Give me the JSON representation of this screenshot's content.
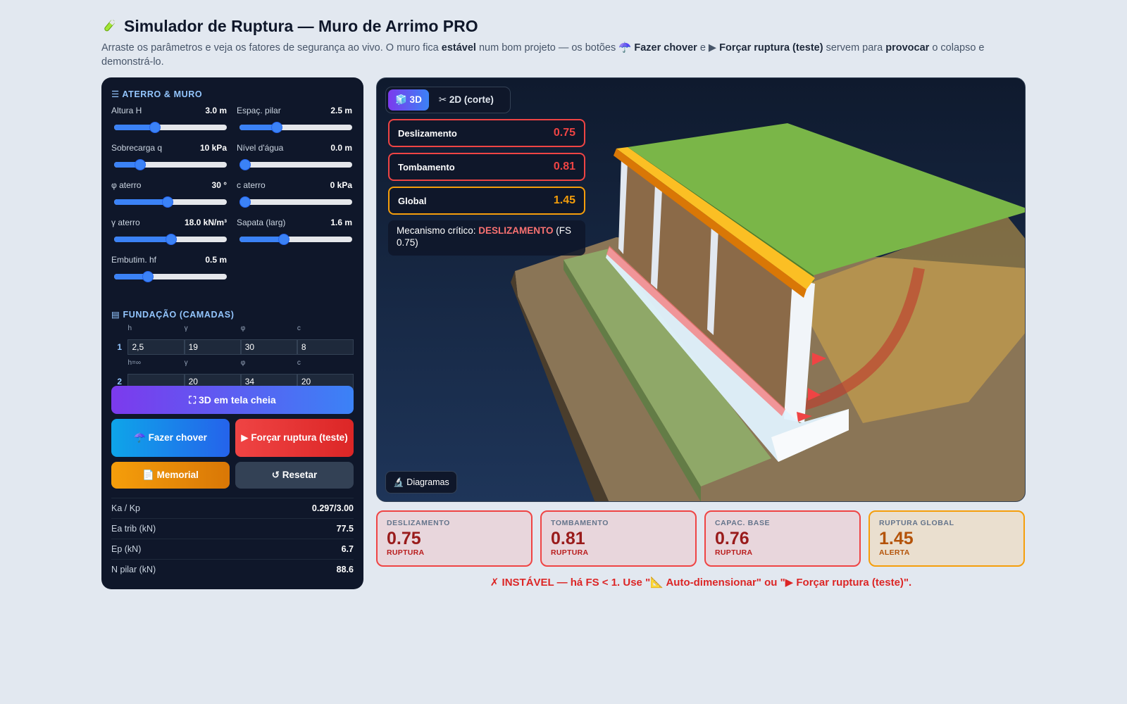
{
  "header": {
    "title": "Simulador de Ruptura — Muro de Arrimo PRO",
    "subtitle_parts": [
      "Arraste os parâmetros e veja os fatores de segurança ao vivo. O muro fica ",
      "estável",
      " num bom projeto — os botões ☂️ ",
      "Fazer chover",
      " e ▶ ",
      "Forçar ruptura (teste)",
      " servem para ",
      "provocar",
      " o colapso e demonstrá-lo."
    ]
  },
  "panel": {
    "section1": "☰ ATERRO & MURO",
    "sliders": [
      {
        "label": "Altura H",
        "value": "3.0 m",
        "level": 0.35
      },
      {
        "label": "Espaç. pilar",
        "value": "2.5 m",
        "level": 0.31
      },
      {
        "label": "Sobrecarga q",
        "value": "10 kPa",
        "level": 0.2
      },
      {
        "label": "Nível d'água",
        "value": "0.0 m",
        "level": 0.0
      },
      {
        "label": "φ aterro",
        "value": "30 °",
        "level": 0.47
      },
      {
        "label": "c aterro",
        "value": "0 kPa",
        "level": 0.0
      },
      {
        "label": "γ aterro",
        "value": "18.0 kN/m³",
        "level": 0.51
      },
      {
        "label": "Sapata (larg)",
        "value": "1.6 m",
        "level": 0.38
      },
      {
        "label": "Embutim. hf",
        "value": "0.5 m",
        "level": 0.28
      }
    ],
    "section2": "▤ FUNDAÇÃO (CAMADAS)",
    "layers": [
      {
        "num": "1",
        "cols": [
          {
            "h": "h",
            "v": "2,5"
          },
          {
            "h": "γ",
            "v": "19"
          },
          {
            "h": "φ",
            "v": "30"
          },
          {
            "h": "c",
            "v": "8"
          }
        ]
      },
      {
        "num": "2",
        "cols": [
          {
            "h": "h=∞",
            "v": ""
          },
          {
            "h": "γ",
            "v": "20"
          },
          {
            "h": "φ",
            "v": "34"
          },
          {
            "h": "c",
            "v": "20"
          }
        ]
      }
    ],
    "buttons": {
      "fullscreen": "⛶ 3D em tela cheia",
      "rain": "☂️ Fazer chover",
      "fail": "▶ Forçar ruptura (teste)",
      "memorial": "📄 Memorial",
      "reset": "↺ Resetar"
    },
    "stats": [
      {
        "k": "Ka / Kp",
        "v": "0.297/3.00"
      },
      {
        "k": "Ea trib (kN)",
        "v": "77.5"
      },
      {
        "k": "Ep (kN)",
        "v": "6.7"
      },
      {
        "k": "N pilar (kN)",
        "v": "88.6"
      }
    ]
  },
  "viewer": {
    "tabs": [
      "🧊 3D",
      "✂ 2D (corte)"
    ],
    "fs": [
      {
        "label": "Deslizamento",
        "value": "0.75"
      },
      {
        "label": "Tombamento",
        "value": "0.81"
      },
      {
        "label": "Global",
        "value": "1.45"
      }
    ],
    "mech_prefix": "Mecanismo crítico: ",
    "mech_name": "DESLIZAMENTO",
    "mech_suffix": " (FS 0.75)",
    "diagrams": "🔬 Diagramas"
  },
  "cards": [
    {
      "key": "DESLIZAMENTO",
      "value": "0.75",
      "status": "RUPTURA"
    },
    {
      "key": "TOMBAMENTO",
      "value": "0.81",
      "status": "RUPTURA"
    },
    {
      "key": "CAPAC. BASE",
      "value": "0.76",
      "status": "RUPTURA"
    },
    {
      "key": "RUPTURA GLOBAL",
      "value": "1.45",
      "status": "ALERTA"
    }
  ],
  "message": "✗ INSTÁVEL — há FS < 1. Use \"📐 Auto-dimensionar\" ou \"▶ Forçar ruptura (teste)\".",
  "colors": {
    "danger": "#ef4444",
    "warning": "#f59e0b",
    "accent": "#3b82f6",
    "panel_bg": "#0f172a"
  }
}
